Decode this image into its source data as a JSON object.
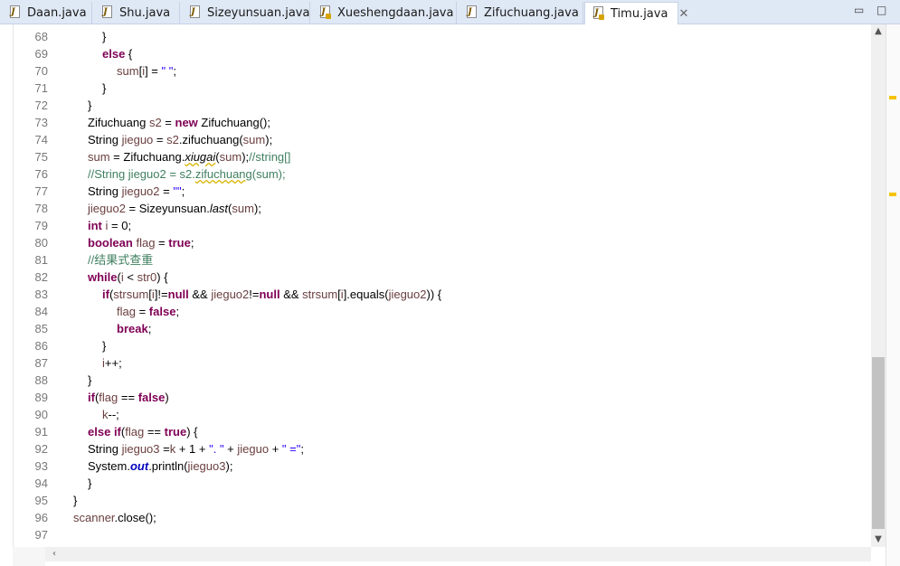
{
  "tabs": [
    {
      "label": "Daan.java",
      "active": false
    },
    {
      "label": "Shu.java",
      "active": false
    },
    {
      "label": "Sizeyunsuan.java",
      "active": false
    },
    {
      "label": "Xueshengdaan.java",
      "active": false
    },
    {
      "label": "Zifuchuang.java",
      "active": false
    },
    {
      "label": "Timu.java",
      "active": true
    }
  ],
  "icons": {
    "tab_file": "java-file-icon",
    "close": "close-icon",
    "minimize": "minimize-icon",
    "maximize": "maximize-icon",
    "scroll_up": "arrow-up-icon",
    "scroll_down": "arrow-down-icon",
    "scroll_left": "arrow-left-icon"
  },
  "glyphs": {
    "close": "✕",
    "minimize": "▭",
    "maximize": "□",
    "up": "▲",
    "down": "▼",
    "left": "‹"
  },
  "colors": {
    "keyword": "#7f0055",
    "variable": "#6a3e3e",
    "string": "#2a00ff",
    "comment": "#3f7f5f",
    "field": "#0000c0",
    "warning_marker": "#f5c400"
  },
  "lines": [
    {
      "n": "68",
      "indent": 2,
      "t": [
        [
          "p",
          "}"
        ]
      ]
    },
    {
      "n": "69",
      "indent": 2,
      "t": [
        [
          "kw",
          "else"
        ],
        [
          "p",
          " {"
        ]
      ]
    },
    {
      "n": "70",
      "indent": 3,
      "t": [
        [
          "var",
          "sum"
        ],
        [
          "p",
          "["
        ],
        [
          "var",
          "i"
        ],
        [
          "p",
          "] = "
        ],
        [
          "str",
          "\" \""
        ],
        [
          "p",
          ";"
        ]
      ]
    },
    {
      "n": "71",
      "indent": 2,
      "t": [
        [
          "p",
          "}"
        ]
      ]
    },
    {
      "n": "72",
      "indent": 1,
      "t": [
        [
          "p",
          "}"
        ]
      ]
    },
    {
      "n": "73",
      "indent": 1,
      "t": [
        [
          "p",
          "Zifuchuang "
        ],
        [
          "var",
          "s2"
        ],
        [
          "p",
          " = "
        ],
        [
          "kw",
          "new"
        ],
        [
          "p",
          " Zifuchuang();"
        ]
      ]
    },
    {
      "n": "74",
      "indent": 1,
      "t": [
        [
          "p",
          "String "
        ],
        [
          "var",
          "jieguo"
        ],
        [
          "p",
          " = "
        ],
        [
          "var",
          "s2"
        ],
        [
          "p",
          ".zifuchuang("
        ],
        [
          "var",
          "sum"
        ],
        [
          "p",
          ");"
        ]
      ]
    },
    {
      "n": "75",
      "indent": 1,
      "t": [
        [
          "var",
          "sum"
        ],
        [
          "p",
          " = Zifuchuang."
        ],
        [
          "stw",
          "xiugai"
        ],
        [
          "p",
          "("
        ],
        [
          "var",
          "sum"
        ],
        [
          "p",
          ");"
        ],
        [
          "cm",
          "//string[]"
        ]
      ]
    },
    {
      "n": "76",
      "indent": 1,
      "t": [
        [
          "cm",
          "//String jieguo2 = s2."
        ],
        [
          "cmw",
          "zifuchuang"
        ],
        [
          "cm",
          "(sum);"
        ]
      ]
    },
    {
      "n": "77",
      "indent": 1,
      "t": [
        [
          "p",
          "String "
        ],
        [
          "var",
          "jieguo2"
        ],
        [
          "p",
          " = "
        ],
        [
          "str",
          "\"\""
        ],
        [
          "p",
          ";"
        ]
      ]
    },
    {
      "n": "78",
      "indent": 1,
      "t": [
        [
          "var",
          "jieguo2"
        ],
        [
          "p",
          " = Sizeyunsuan."
        ],
        [
          "st",
          "last"
        ],
        [
          "p",
          "("
        ],
        [
          "var",
          "sum"
        ],
        [
          "p",
          ");"
        ]
      ]
    },
    {
      "n": "79",
      "indent": 1,
      "t": [
        [
          "kw",
          "int"
        ],
        [
          "p",
          " "
        ],
        [
          "var",
          "i"
        ],
        [
          "p",
          " = 0;"
        ]
      ]
    },
    {
      "n": "80",
      "indent": 1,
      "t": [
        [
          "kw",
          "boolean"
        ],
        [
          "p",
          " "
        ],
        [
          "var",
          "flag"
        ],
        [
          "p",
          " = "
        ],
        [
          "kw",
          "true"
        ],
        [
          "p",
          ";"
        ]
      ]
    },
    {
      "n": "81",
      "indent": 1,
      "t": [
        [
          "cm",
          "//结果式查重"
        ]
      ]
    },
    {
      "n": "82",
      "indent": 1,
      "t": [
        [
          "kw",
          "while"
        ],
        [
          "p",
          "("
        ],
        [
          "var",
          "i"
        ],
        [
          "p",
          " < "
        ],
        [
          "var",
          "str0"
        ],
        [
          "p",
          ") {"
        ]
      ]
    },
    {
      "n": "83",
      "indent": 2,
      "t": [
        [
          "kw",
          "if"
        ],
        [
          "p",
          "("
        ],
        [
          "var",
          "strsum"
        ],
        [
          "p",
          "["
        ],
        [
          "var",
          "i"
        ],
        [
          "p",
          "]!="
        ],
        [
          "kw",
          "null"
        ],
        [
          "p",
          " && "
        ],
        [
          "var",
          "jieguo2"
        ],
        [
          "p",
          "!="
        ],
        [
          "kw",
          "null"
        ],
        [
          "p",
          " && "
        ],
        [
          "var",
          "strsum"
        ],
        [
          "p",
          "["
        ],
        [
          "var",
          "i"
        ],
        [
          "p",
          "].equals("
        ],
        [
          "var",
          "jieguo2"
        ],
        [
          "p",
          ")) {"
        ]
      ]
    },
    {
      "n": "84",
      "indent": 3,
      "t": [
        [
          "var",
          "flag"
        ],
        [
          "p",
          " = "
        ],
        [
          "kw",
          "false"
        ],
        [
          "p",
          ";"
        ]
      ]
    },
    {
      "n": "85",
      "indent": 3,
      "t": [
        [
          "kw",
          "break"
        ],
        [
          "p",
          ";"
        ]
      ]
    },
    {
      "n": "86",
      "indent": 2,
      "t": [
        [
          "p",
          "}"
        ]
      ]
    },
    {
      "n": "87",
      "indent": 2,
      "t": [
        [
          "var",
          "i"
        ],
        [
          "p",
          "++;"
        ]
      ]
    },
    {
      "n": "88",
      "indent": 1,
      "t": [
        [
          "p",
          "}"
        ]
      ]
    },
    {
      "n": "89",
      "indent": 1,
      "t": [
        [
          "kw",
          "if"
        ],
        [
          "p",
          "("
        ],
        [
          "var",
          "flag"
        ],
        [
          "p",
          " == "
        ],
        [
          "kw",
          "false"
        ],
        [
          "p",
          ")"
        ]
      ]
    },
    {
      "n": "90",
      "indent": 2,
      "t": [
        [
          "var",
          "k"
        ],
        [
          "p",
          "--;"
        ]
      ]
    },
    {
      "n": "91",
      "indent": 1,
      "t": [
        [
          "kw",
          "else"
        ],
        [
          "p",
          " "
        ],
        [
          "kw",
          "if"
        ],
        [
          "p",
          "("
        ],
        [
          "var",
          "flag"
        ],
        [
          "p",
          " == "
        ],
        [
          "kw",
          "true"
        ],
        [
          "p",
          ") {"
        ]
      ]
    },
    {
      "n": "92",
      "indent": 1,
      "t": [
        [
          "p",
          "String "
        ],
        [
          "var",
          "jieguo3"
        ],
        [
          "p",
          " ="
        ],
        [
          "var",
          "k"
        ],
        [
          "p",
          " + 1 + "
        ],
        [
          "str",
          "\". \""
        ],
        [
          "p",
          " + "
        ],
        [
          "var",
          "jieguo"
        ],
        [
          "p",
          " + "
        ],
        [
          "str",
          "\" =\""
        ],
        [
          "p",
          ";"
        ]
      ]
    },
    {
      "n": "93",
      "indent": 1,
      "t": [
        [
          "p",
          "System."
        ],
        [
          "fld",
          "out"
        ],
        [
          "p",
          ".println("
        ],
        [
          "var",
          "jieguo3"
        ],
        [
          "p",
          ");"
        ]
      ]
    },
    {
      "n": "94",
      "indent": 1,
      "t": [
        [
          "p",
          "}"
        ]
      ]
    },
    {
      "n": "95",
      "indent": 0,
      "t": [
        [
          "p",
          "}"
        ]
      ]
    },
    {
      "n": "96",
      "indent": 0,
      "t": [
        [
          "var",
          "scanner"
        ],
        [
          "p",
          ".close();"
        ]
      ]
    },
    {
      "n": "97",
      "indent": 0,
      "t": []
    }
  ]
}
